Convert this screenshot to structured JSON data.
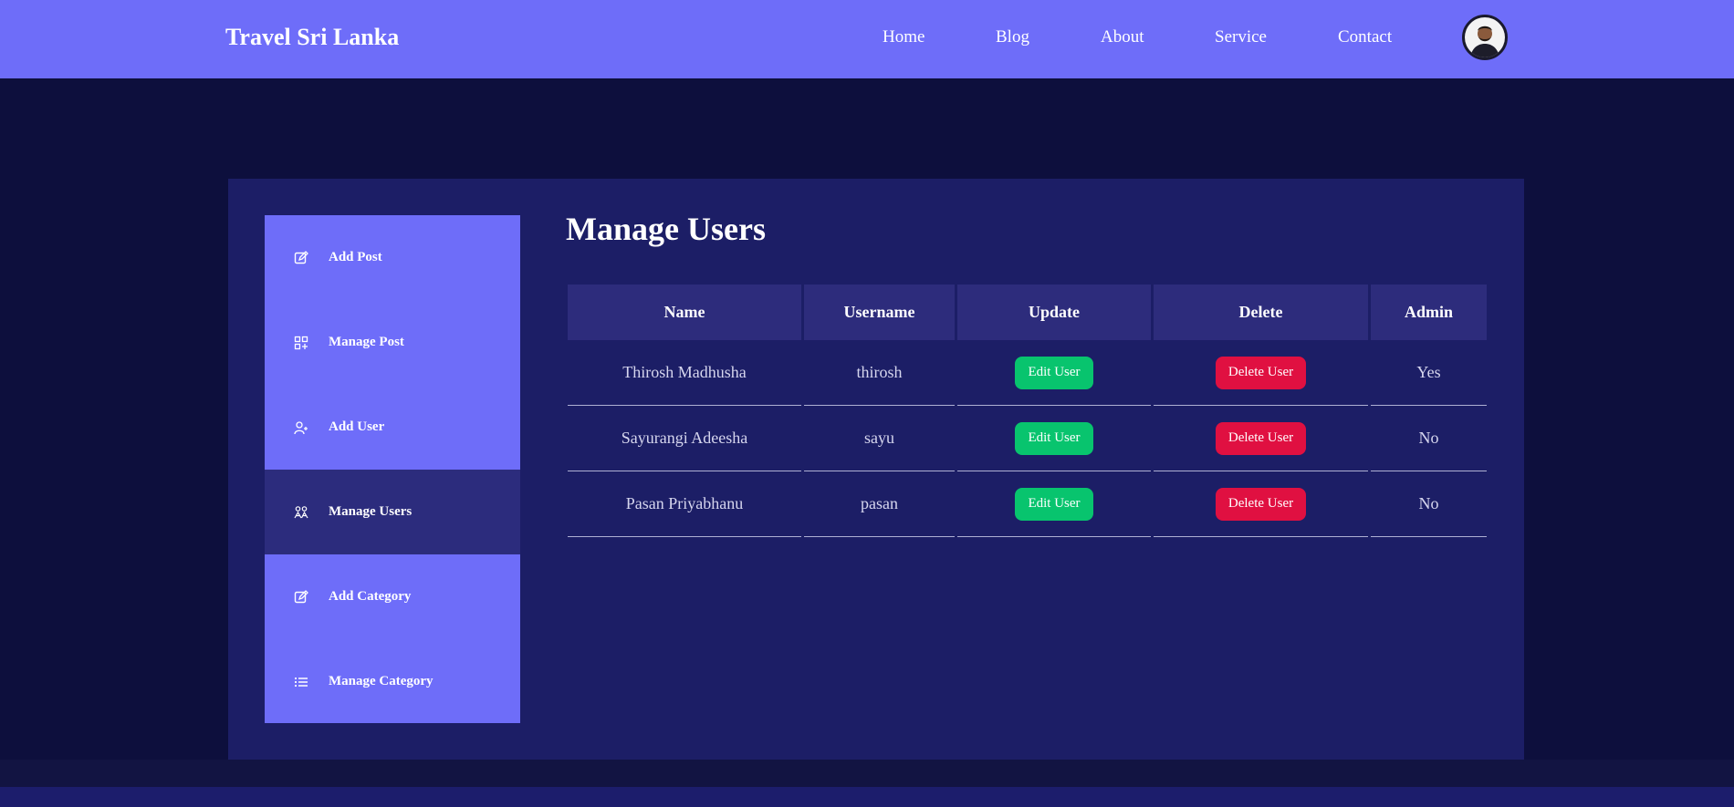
{
  "header": {
    "brand": "Travel Sri Lanka",
    "nav": [
      "Home",
      "Blog",
      "About",
      "Service",
      "Contact"
    ]
  },
  "sidebar": {
    "items": [
      {
        "label": "Add Post",
        "icon": "edit-icon"
      },
      {
        "label": "Manage Post",
        "icon": "grid-plus-icon"
      },
      {
        "label": "Add User",
        "icon": "user-plus-icon"
      },
      {
        "label": "Manage Users",
        "icon": "users-icon",
        "active": true
      },
      {
        "label": "Add Category",
        "icon": "edit-icon"
      },
      {
        "label": "Manage Category",
        "icon": "list-icon"
      }
    ]
  },
  "main": {
    "title": "Manage Users",
    "table": {
      "headers": [
        "Name",
        "Username",
        "Update",
        "Delete",
        "Admin"
      ],
      "rows": [
        {
          "name": "Thirosh Madhusha",
          "username": "thirosh",
          "update": "Edit User",
          "delete": "Delete User",
          "admin": "Yes"
        },
        {
          "name": "Sayurangi Adeesha",
          "username": "sayu",
          "update": "Edit User",
          "delete": "Delete User",
          "admin": "No"
        },
        {
          "name": "Pasan Priyabhanu",
          "username": "pasan",
          "update": "Edit User",
          "delete": "Delete User",
          "admin": "No"
        }
      ]
    }
  },
  "colors": {
    "accent": "#6e6df9",
    "background": "#0d0f3d",
    "panel": "#1c1e66",
    "edit": "#08c46e",
    "delete": "#e01041"
  }
}
